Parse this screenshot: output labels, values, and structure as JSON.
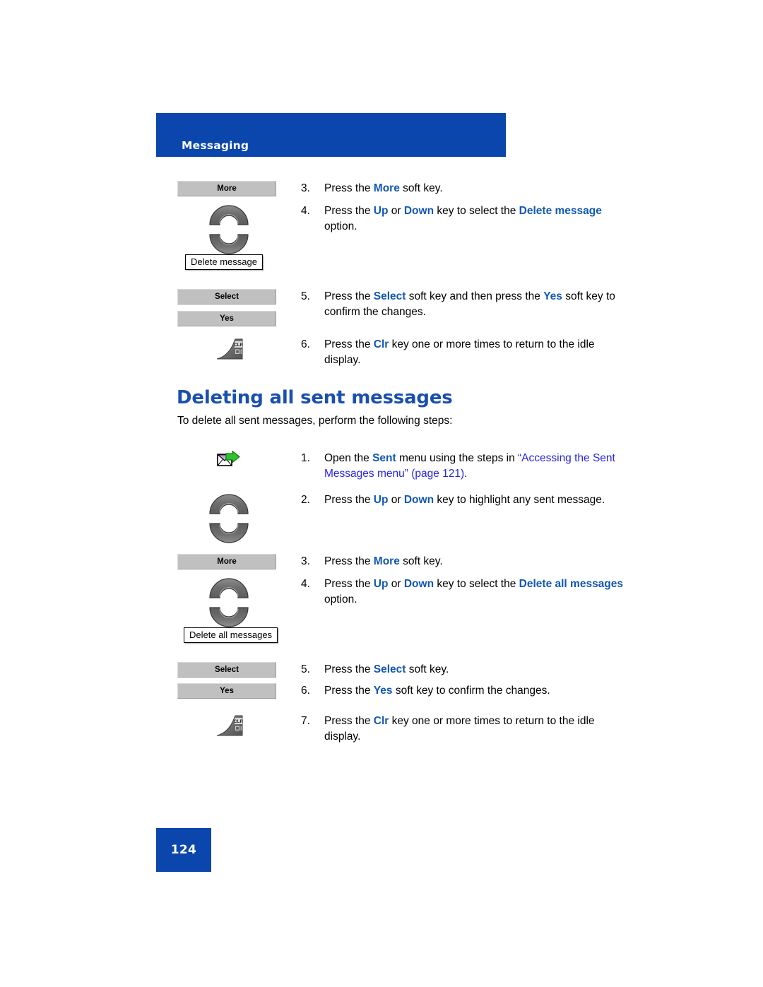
{
  "header": {
    "title": "Messaging"
  },
  "colors": {
    "banner_blue": "#0a46ab",
    "heading_blue": "#1a4faf",
    "keyword_blue": "#1157b4",
    "xref_blue": "#2626e0",
    "softkey_gray": "#c0c0c0"
  },
  "section_top": {
    "steps": [
      {
        "number": "3.",
        "art": "softkey",
        "art_label": "More",
        "text_parts": [
          {
            "t": "Press the ",
            "style": "plain"
          },
          {
            "t": "More",
            "style": "kw"
          },
          {
            "t": " soft key.",
            "style": "plain"
          }
        ]
      },
      {
        "number": "4.",
        "art": "navkeys-with-menubox",
        "menubox_label": "Delete message",
        "text_parts": [
          {
            "t": "Press the ",
            "style": "plain"
          },
          {
            "t": "Up",
            "style": "kw"
          },
          {
            "t": " or ",
            "style": "plain"
          },
          {
            "t": "Down",
            "style": "kw"
          },
          {
            "t": " key to select the ",
            "style": "plain"
          },
          {
            "t": "Delete message",
            "style": "kw"
          },
          {
            "t": " option.",
            "style": "plain"
          }
        ]
      },
      {
        "number": "5.",
        "art": "softkey-pair",
        "art_label": "Select",
        "art_label2": "Yes",
        "text_parts": [
          {
            "t": "Press the ",
            "style": "plain"
          },
          {
            "t": "Select",
            "style": "kw"
          },
          {
            "t": " soft key and then press the ",
            "style": "plain"
          },
          {
            "t": "Yes",
            "style": "kw"
          },
          {
            "t": " soft key to confirm the changes.",
            "style": "plain"
          }
        ]
      },
      {
        "number": "6.",
        "art": "clrkey",
        "art_label": "CLR",
        "text_parts": [
          {
            "t": "Press the ",
            "style": "plain"
          },
          {
            "t": "Clr",
            "style": "kw"
          },
          {
            "t": " key one or more times to return to the idle display.",
            "style": "plain"
          }
        ]
      }
    ]
  },
  "section_main": {
    "heading": "Deleting all sent messages",
    "intro": "To delete all sent messages, perform the following steps:",
    "steps": [
      {
        "number": "1.",
        "art": "sent-envelope-icon",
        "text_parts": [
          {
            "t": "Open the ",
            "style": "plain"
          },
          {
            "t": "Sent",
            "style": "kw"
          },
          {
            "t": " menu using the steps in ",
            "style": "plain"
          },
          {
            "t": "“Accessing the Sent Messages menu” (page 121)",
            "style": "xref"
          },
          {
            "t": ".",
            "style": "plain"
          }
        ]
      },
      {
        "number": "2.",
        "art": "navkeys",
        "text_parts": [
          {
            "t": "Press the ",
            "style": "plain"
          },
          {
            "t": "Up",
            "style": "kw"
          },
          {
            "t": " or ",
            "style": "plain"
          },
          {
            "t": "Down",
            "style": "kw"
          },
          {
            "t": " key to highlight any sent message.",
            "style": "plain"
          }
        ]
      },
      {
        "number": "3.",
        "art": "softkey",
        "art_label": "More",
        "text_parts": [
          {
            "t": "Press the ",
            "style": "plain"
          },
          {
            "t": "More",
            "style": "kw"
          },
          {
            "t": " soft key.",
            "style": "plain"
          }
        ]
      },
      {
        "number": "4.",
        "art": "navkeys-with-menubox",
        "menubox_label": "Delete all messages",
        "text_parts": [
          {
            "t": "Press the ",
            "style": "plain"
          },
          {
            "t": "Up",
            "style": "kw"
          },
          {
            "t": " or ",
            "style": "plain"
          },
          {
            "t": "Down",
            "style": "kw"
          },
          {
            "t": " key to select the ",
            "style": "plain"
          },
          {
            "t": "Delete all messages",
            "style": "kw"
          },
          {
            "t": " option.",
            "style": "plain"
          }
        ]
      },
      {
        "number": "5.",
        "art": "softkey",
        "art_label": "Select",
        "text_parts": [
          {
            "t": "Press the ",
            "style": "plain"
          },
          {
            "t": "Select",
            "style": "kw"
          },
          {
            "t": " soft key.",
            "style": "plain"
          }
        ]
      },
      {
        "number": "6.",
        "art": "softkey",
        "art_label": "Yes",
        "text_parts": [
          {
            "t": "Press the ",
            "style": "plain"
          },
          {
            "t": "Yes",
            "style": "kw"
          },
          {
            "t": " soft key to confirm the changes.",
            "style": "plain"
          }
        ]
      },
      {
        "number": "7.",
        "art": "clrkey",
        "art_label": "CLR",
        "text_parts": [
          {
            "t": "Press the ",
            "style": "plain"
          },
          {
            "t": "Clr",
            "style": "kw"
          },
          {
            "t": " key one or more times to return to the idle display.",
            "style": "plain"
          }
        ]
      }
    ]
  },
  "footer": {
    "page_number": "124"
  }
}
